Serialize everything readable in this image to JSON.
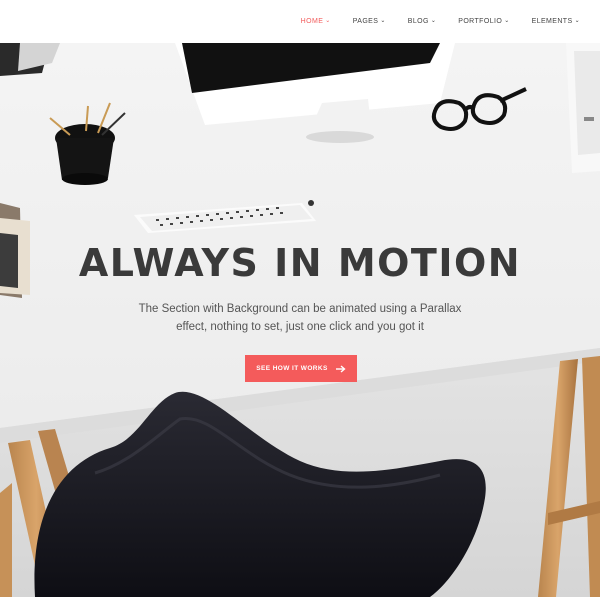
{
  "nav": {
    "items": [
      {
        "label": "HOME",
        "active": true
      },
      {
        "label": "PAGES",
        "active": false
      },
      {
        "label": "BLOG",
        "active": false
      },
      {
        "label": "PORTFOLIO",
        "active": false
      },
      {
        "label": "ELEMENTS",
        "active": false
      }
    ],
    "caret_icon": "chevron-down-icon"
  },
  "hero": {
    "title": "ALWAYS IN MOTION",
    "subtitle_line1": "The Section with Background can be animated using a Parallax",
    "subtitle_line2": "effect, nothing to set, just one click and you got it",
    "cta_label": "SEE HOW IT WORKS",
    "cta_icon": "arrow-right-icon"
  },
  "colors": {
    "accent": "#f45b5b",
    "nav_active": "#f25c5c",
    "title": "#3a3a3a",
    "body_text": "#555555"
  }
}
